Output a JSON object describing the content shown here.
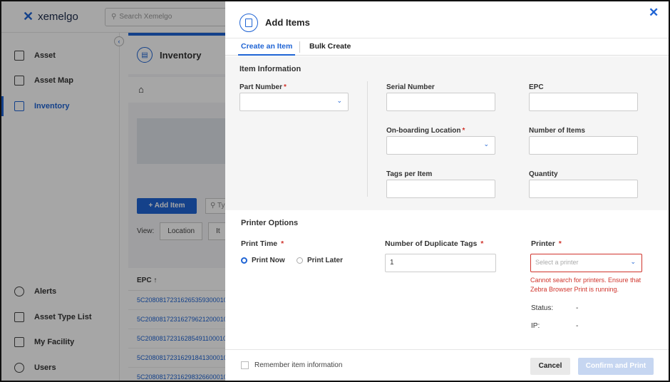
{
  "app": {
    "logo_text": "xemelgo",
    "search_placeholder": "Search Xemelgo"
  },
  "sidebar": {
    "items": [
      {
        "label": "Asset",
        "icon": "clipboard-icon"
      },
      {
        "label": "Asset Map",
        "icon": "map-icon"
      },
      {
        "label": "Inventory",
        "icon": "inventory-icon",
        "active": true
      },
      {
        "label": "Alerts",
        "icon": "bell-icon"
      },
      {
        "label": "Asset Type List",
        "icon": "list-icon"
      },
      {
        "label": "My Facility",
        "icon": "facility-icon"
      },
      {
        "label": "Users",
        "icon": "user-icon"
      }
    ]
  },
  "page": {
    "title": "Inventory",
    "add_item_label": "+ Add Item",
    "search_placeholder": "Ty",
    "view_label": "View:",
    "view_location": "Location",
    "view_item": "It",
    "table_header": "EPC ↑",
    "epc_rows": [
      "5C20808172316265359300010",
      "5C20808172316279621200010",
      "5C20808172316285491100010",
      "5C20808172316291841300010",
      "5C20808172316298326600010"
    ]
  },
  "modal": {
    "title": "Add Items",
    "tabs": [
      {
        "label": "Create an Item",
        "active": true
      },
      {
        "label": "Bulk Create",
        "active": false
      }
    ],
    "item_info": {
      "title": "Item Information",
      "part_number_label": "Part Number",
      "serial_number_label": "Serial Number",
      "epc_label": "EPC",
      "onboarding_location_label": "On-boarding Location",
      "number_of_items_label": "Number of Items",
      "tags_per_item_label": "Tags per Item",
      "quantity_label": "Quantity"
    },
    "printer_options": {
      "title": "Printer Options",
      "print_time_label": "Print Time",
      "print_now_label": "Print Now",
      "print_later_label": "Print Later",
      "duplicate_tags_label": "Number of Duplicate Tags",
      "duplicate_tags_value": "1",
      "printer_label": "Printer",
      "printer_placeholder": "Select a printer",
      "error_text": "Cannot search for printers. Ensure that Zebra Browser Print is running.",
      "status_label": "Status:",
      "status_value": "-",
      "ip_label": "IP:",
      "ip_value": "-"
    },
    "footer": {
      "remember_label": "Remember item information",
      "cancel_label": "Cancel",
      "confirm_label": "Confirm and Print"
    }
  },
  "colors": {
    "accent": "#1f64d4",
    "error": "#d0342c"
  }
}
